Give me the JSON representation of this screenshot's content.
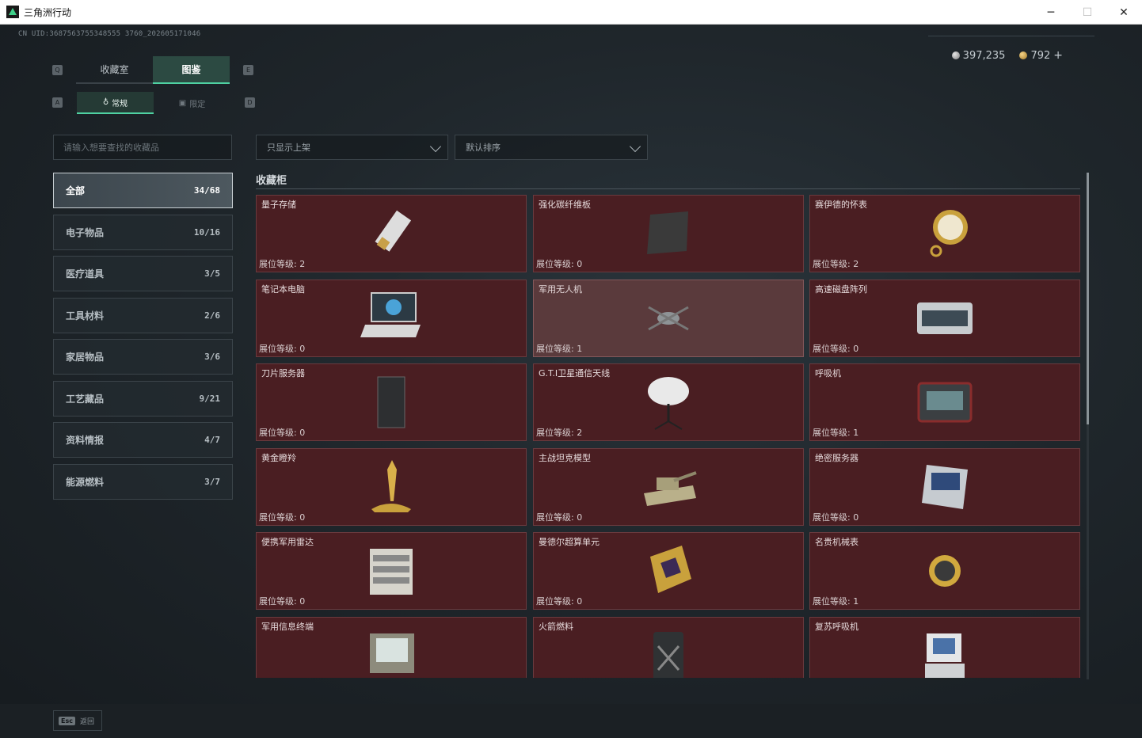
{
  "window": {
    "title": "三角洲行动",
    "controls": {
      "minimize": "─",
      "maximize": "☐",
      "close": "✕"
    }
  },
  "header": {
    "uid": "CN UID:3687563755348555 3760_202605171046",
    "currency": {
      "silver": "397,235",
      "gold": "792",
      "add": "+"
    }
  },
  "keyhints": {
    "prev_tab": "Q",
    "next_tab": "E",
    "prev_sub": "A",
    "next_sub": "D"
  },
  "tabs": [
    {
      "label": "收藏室"
    },
    {
      "label": "图鉴"
    }
  ],
  "subtabs": [
    {
      "label": "常规"
    },
    {
      "label": "限定"
    }
  ],
  "search": {
    "placeholder": "请输入想要查找的收藏品"
  },
  "filters": {
    "shelf": "只显示上架",
    "sort": "默认排序"
  },
  "categories": [
    {
      "label": "全部",
      "count": "34/68"
    },
    {
      "label": "电子物品",
      "count": "10/16"
    },
    {
      "label": "医疗道具",
      "count": "3/5"
    },
    {
      "label": "工具材料",
      "count": "2/6"
    },
    {
      "label": "家居物品",
      "count": "3/6"
    },
    {
      "label": "工艺藏品",
      "count": "9/21"
    },
    {
      "label": "资料情报",
      "count": "4/7"
    },
    {
      "label": "能源燃料",
      "count": "3/7"
    }
  ],
  "section": {
    "title": "收藏柜"
  },
  "items": [
    {
      "name": "量子存储",
      "level": "展位等级: 2",
      "icon": "usb-drive-icon"
    },
    {
      "name": "强化碳纤维板",
      "level": "展位等级: 0",
      "icon": "carbon-plate-icon"
    },
    {
      "name": "赛伊德的怀表",
      "level": "展位等级: 2",
      "icon": "pocket-watch-icon"
    },
    {
      "name": "笔记本电脑",
      "level": "展位等级: 0",
      "icon": "laptop-icon"
    },
    {
      "name": "军用无人机",
      "level": "展位等级: 1",
      "icon": "drone-icon"
    },
    {
      "name": "高速磁盘阵列",
      "level": "展位等级: 0",
      "icon": "disk-array-icon"
    },
    {
      "name": "刀片服务器",
      "level": "展位等级: 0",
      "icon": "blade-server-icon"
    },
    {
      "name": "G.T.I卫星通信天线",
      "level": "展位等级: 2",
      "icon": "satellite-dish-icon"
    },
    {
      "name": "呼吸机",
      "level": "展位等级: 1",
      "icon": "ventilator-icon"
    },
    {
      "name": "黄金瞪羚",
      "level": "展位等级: 0",
      "icon": "gold-gazelle-icon"
    },
    {
      "name": "主战坦克模型",
      "level": "展位等级: 0",
      "icon": "tank-model-icon"
    },
    {
      "name": "绝密服务器",
      "level": "展位等级: 0",
      "icon": "secret-server-icon"
    },
    {
      "name": "便携军用雷达",
      "level": "展位等级: 0",
      "icon": "radar-icon"
    },
    {
      "name": "曼德尔超算单元",
      "level": "展位等级: 0",
      "icon": "compute-unit-icon"
    },
    {
      "name": "名贵机械表",
      "level": "展位等级: 1",
      "icon": "wristwatch-icon"
    },
    {
      "name": "军用信息终端",
      "level": "",
      "icon": "terminal-icon"
    },
    {
      "name": "火箭燃料",
      "level": "",
      "icon": "fuel-can-icon"
    },
    {
      "name": "复苏呼吸机",
      "level": "",
      "icon": "resuscitator-icon"
    }
  ],
  "footer": {
    "esc_key": "Esc",
    "esc_label": "返回"
  }
}
